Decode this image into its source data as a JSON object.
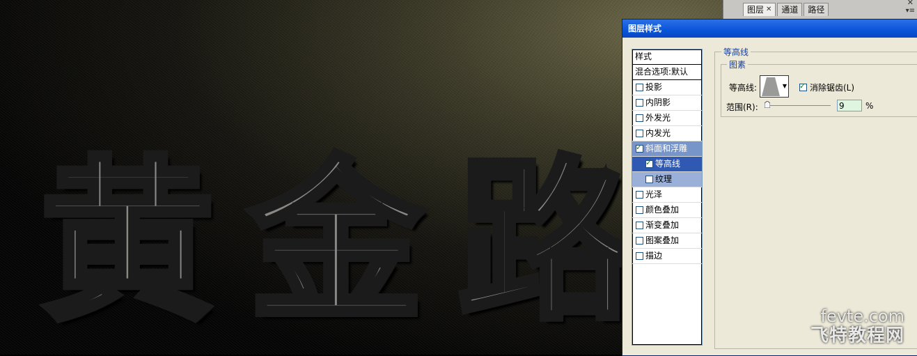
{
  "canvas": {
    "text_chars": [
      "黄",
      "金",
      "路"
    ]
  },
  "layers_panel": {
    "tabs": [
      {
        "label": "图层",
        "active": true,
        "closable": true
      },
      {
        "label": "通道",
        "active": false,
        "closable": false
      },
      {
        "label": "路径",
        "active": false,
        "closable": false
      }
    ],
    "close_glyph": "✕",
    "menu_glyph": "▾≡"
  },
  "dialog": {
    "title": "图层样式",
    "list_header": "样式",
    "blend_options": "混合选项:默认",
    "items": [
      {
        "label": "投影",
        "checked": false
      },
      {
        "label": "内阴影",
        "checked": false
      },
      {
        "label": "外发光",
        "checked": false
      },
      {
        "label": "内发光",
        "checked": false
      },
      {
        "label": "斜面和浮雕",
        "checked": true
      },
      {
        "label": "等高线",
        "checked": true
      },
      {
        "label": "纹理",
        "checked": false
      },
      {
        "label": "光泽",
        "checked": false
      },
      {
        "label": "颜色叠加",
        "checked": false
      },
      {
        "label": "渐变叠加",
        "checked": false
      },
      {
        "label": "图案叠加",
        "checked": false
      },
      {
        "label": "描边",
        "checked": false
      }
    ],
    "group_title": "等高线",
    "subgroup_title": "图素",
    "contour_label": "等高线:",
    "anti_alias_label": "消除锯齿(L)",
    "anti_alias_checked": true,
    "range_label": "范围(R):",
    "range_value": "9",
    "range_unit": "%"
  },
  "watermark": {
    "line1": "fevte.com",
    "line2": "飞特教程网"
  },
  "colors": {
    "titlebar": "#0a54d8",
    "selected_item": "#7895c9",
    "child_selected": "#2f59b3"
  }
}
